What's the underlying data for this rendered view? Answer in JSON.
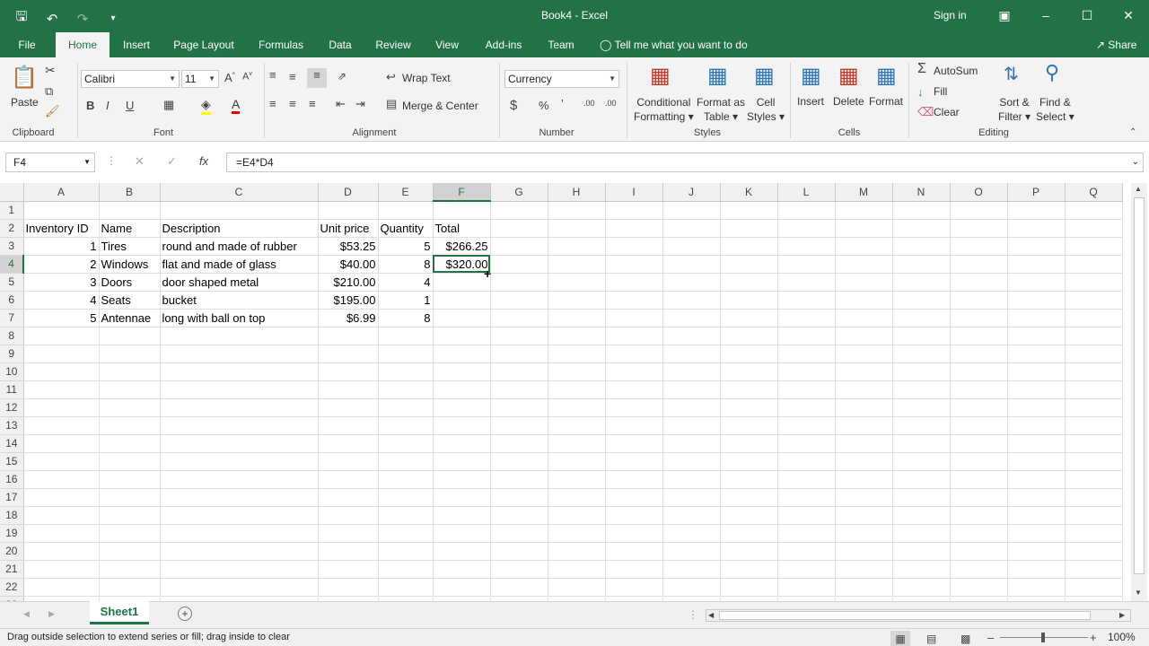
{
  "window": {
    "title": "Book4  -  Excel",
    "signin": "Sign in"
  },
  "tabs": [
    "File",
    "Home",
    "Insert",
    "Page Layout",
    "Formulas",
    "Data",
    "Review",
    "View",
    "Add-ins",
    "Team"
  ],
  "tell_me": "Tell me what you want to do",
  "share": "Share",
  "ribbon": {
    "clipboard": {
      "label": "Clipboard",
      "paste": "Paste"
    },
    "font": {
      "label": "Font",
      "name": "Calibri",
      "size": "11"
    },
    "alignment": {
      "label": "Alignment",
      "wrap": "Wrap Text",
      "merge": "Merge & Center"
    },
    "number": {
      "label": "Number",
      "format": "Currency"
    },
    "styles": {
      "label": "Styles",
      "cond1": "Conditional",
      "cond2": "Formatting",
      "fmt1": "Format as",
      "fmt2": "Table",
      "cell1": "Cell",
      "cell2": "Styles"
    },
    "cells": {
      "label": "Cells",
      "insert": "Insert",
      "delete": "Delete",
      "format": "Format"
    },
    "editing": {
      "label": "Editing",
      "autosum": "AutoSum",
      "fill": "Fill",
      "clear": "Clear",
      "sort1": "Sort &",
      "sort2": "Filter",
      "find1": "Find &",
      "find2": "Select"
    }
  },
  "formula_bar": {
    "name_box": "F4",
    "formula": "=E4*D4"
  },
  "columns": [
    "A",
    "B",
    "C",
    "D",
    "E",
    "F",
    "G",
    "H",
    "I",
    "J",
    "K",
    "L",
    "M",
    "N",
    "O",
    "P",
    "Q"
  ],
  "rows": [
    [
      "",
      "",
      "",
      "",
      "",
      ""
    ],
    [
      "Inventory ID",
      "Name",
      "Description",
      "Unit price",
      "Quantity",
      "Total"
    ],
    [
      "1",
      "Tires",
      "round and made of rubber",
      "$53.25",
      "5",
      "$266.25"
    ],
    [
      "2",
      "Windows",
      "flat and made of glass",
      "$40.00",
      "8",
      "$320.00"
    ],
    [
      "3",
      "Doors",
      "door shaped metal",
      "$210.00",
      "4",
      ""
    ],
    [
      "4",
      "Seats",
      "bucket",
      "$195.00",
      "1",
      ""
    ],
    [
      "5",
      "Antennae",
      "long with ball on top",
      "$6.99",
      "8",
      ""
    ]
  ],
  "selected_cell": "F4",
  "sheet_tab": "Sheet1",
  "status": {
    "message": "Drag outside selection to extend series or fill; drag inside to clear",
    "zoom": "100%"
  }
}
